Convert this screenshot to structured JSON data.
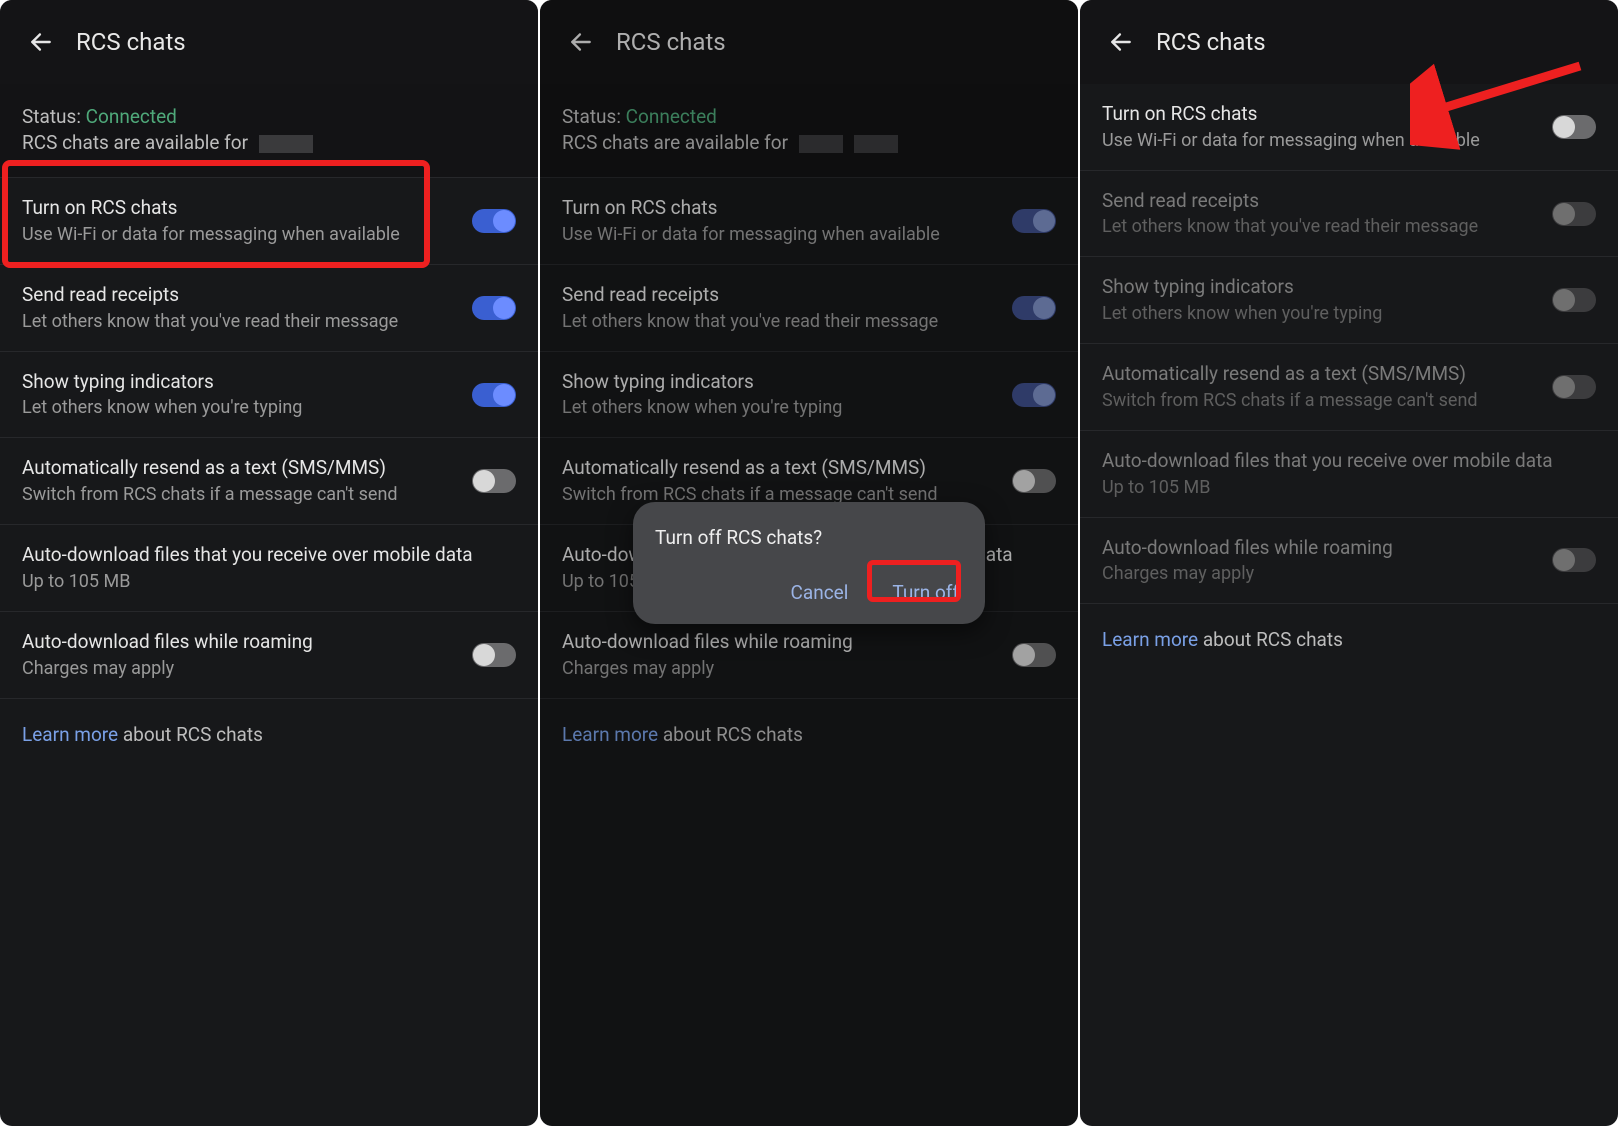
{
  "common": {
    "page_title": "RCS chats",
    "status_label": "Status:",
    "status_value": "Connected",
    "status_sub": "RCS chats are available for",
    "learn_link": "Learn more",
    "learn_rest": " about RCS chats"
  },
  "rows": {
    "turn_on": {
      "title": "Turn on RCS chats",
      "sub": "Use Wi-Fi or data for messaging when available"
    },
    "receipts": {
      "title": "Send read receipts",
      "sub": "Let others know that you've read their message"
    },
    "typing": {
      "title": "Show typing indicators",
      "sub": "Let others know when you're typing"
    },
    "resend": {
      "title": "Automatically resend as a text (SMS/MMS)",
      "sub": "Switch from RCS chats if a message can't send"
    },
    "autodl": {
      "title": "Auto-download files that you receive over mobile data",
      "sub": "Up to 105 MB"
    },
    "roaming": {
      "title": "Auto-download files while roaming",
      "sub": "Charges may apply"
    }
  },
  "dialog": {
    "title": "Turn off RCS chats?",
    "cancel": "Cancel",
    "turn_off": "Turn off"
  }
}
